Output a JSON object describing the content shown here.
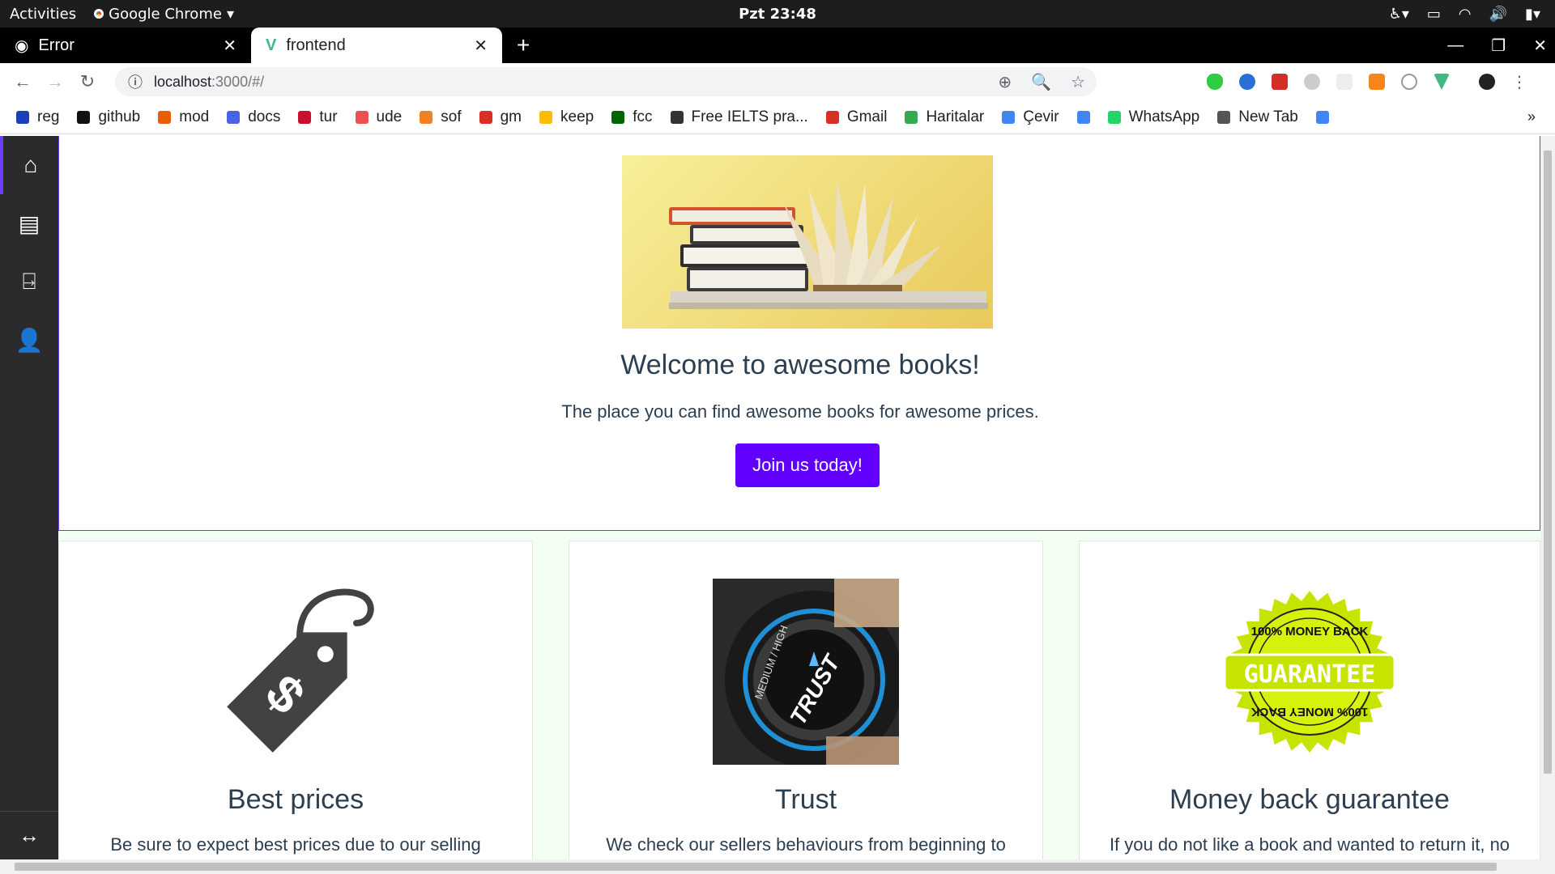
{
  "system": {
    "activities": "Activities",
    "app_name": "Google Chrome",
    "clock": "Pzt 23:48"
  },
  "tabs": [
    {
      "title": "Error",
      "active": false
    },
    {
      "title": "frontend",
      "active": true
    }
  ],
  "omnibox": {
    "host": "localhost",
    "rest": ":3000/#/"
  },
  "bookmarks": [
    {
      "label": "reg",
      "color": "#1a3fb8"
    },
    {
      "label": "github",
      "color": "#111111"
    },
    {
      "label": "mod",
      "color": "#e85d00"
    },
    {
      "label": "docs",
      "color": "#4a63e6"
    },
    {
      "label": "tur",
      "color": "#c8102e"
    },
    {
      "label": "ude",
      "color": "#ec5252"
    },
    {
      "label": "sof",
      "color": "#f48024"
    },
    {
      "label": "gm",
      "color": "#d93025"
    },
    {
      "label": "keep",
      "color": "#fbbc04"
    },
    {
      "label": "fcc",
      "color": "#006400"
    },
    {
      "label": "Free IELTS pra...",
      "color": "#333333"
    },
    {
      "label": "Gmail",
      "color": "#d93025"
    },
    {
      "label": "Haritalar",
      "color": "#34a853"
    },
    {
      "label": "Çevir",
      "color": "#4285f4"
    },
    {
      "label": "",
      "color": "#4285f4"
    },
    {
      "label": "WhatsApp",
      "color": "#25d366"
    },
    {
      "label": "New Tab",
      "color": "#555555"
    },
    {
      "label": "",
      "color": "#4285f4"
    }
  ],
  "hero": {
    "title": "Welcome to awesome books!",
    "subtitle": "The place you can find awesome books for awesome prices.",
    "cta": "Join us today!"
  },
  "features": [
    {
      "title": "Best prices",
      "text": "Be sure to expect best prices due to our selling"
    },
    {
      "title": "Trust",
      "text": "We check our sellers behaviours from beginning to"
    },
    {
      "title": "Money back guarantee",
      "text": "If you do not like a book and wanted to return it, no"
    }
  ],
  "guarantee": {
    "top": "100% MONEY BACK",
    "main": "GUARANTEE",
    "bottom": "100% MONEY BACK"
  },
  "trust_dial": {
    "word": "TRUST",
    "scale": "MEDIUM / HIGH"
  },
  "colors": {
    "accent": "#6200ff",
    "sidebar": "#2b2b2e",
    "text": "#2c3e50",
    "features_bg": "#f3fff3"
  }
}
